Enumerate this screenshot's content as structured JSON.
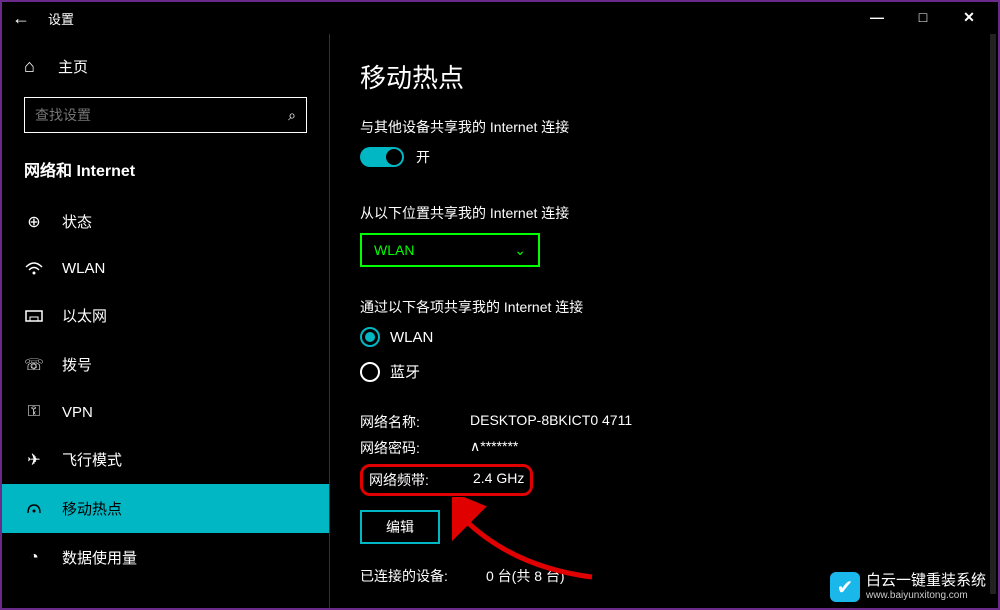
{
  "window": {
    "title": "设置",
    "minimize": "—",
    "maximize": "□",
    "close": "✕"
  },
  "sidebar": {
    "home": "主页",
    "search_placeholder": "查找设置",
    "section": "网络和 Internet",
    "items": [
      {
        "icon": "status",
        "label": "状态"
      },
      {
        "icon": "wifi",
        "label": "WLAN"
      },
      {
        "icon": "ethernet",
        "label": "以太网"
      },
      {
        "icon": "dialup",
        "label": "拨号"
      },
      {
        "icon": "vpn",
        "label": "VPN"
      },
      {
        "icon": "airplane",
        "label": "飞行模式"
      },
      {
        "icon": "hotspot",
        "label": "移动热点"
      },
      {
        "icon": "data",
        "label": "数据使用量"
      }
    ],
    "active_index": 6
  },
  "main": {
    "title": "移动热点",
    "share_label": "与其他设备共享我的 Internet 连接",
    "toggle_state": "开",
    "share_from_label": "从以下位置共享我的 Internet 连接",
    "share_from_value": "WLAN",
    "share_via_label": "通过以下各项共享我的 Internet 连接",
    "radio_options": [
      {
        "label": "WLAN",
        "checked": true
      },
      {
        "label": "蓝牙",
        "checked": false
      }
    ],
    "network_name_label": "网络名称:",
    "network_name_value": "DESKTOP-8BKICT0 4711",
    "network_password_label": "网络密码:",
    "network_password_value": "∧*******",
    "network_band_label": "网络频带:",
    "network_band_value": "2.4 GHz",
    "edit_button": "编辑",
    "connected_label": "已连接的设备:",
    "connected_value": "0 台(共 8 台)"
  },
  "watermark": {
    "text": "白云一键重装系统",
    "url": "www.baiyunxitong.com"
  }
}
